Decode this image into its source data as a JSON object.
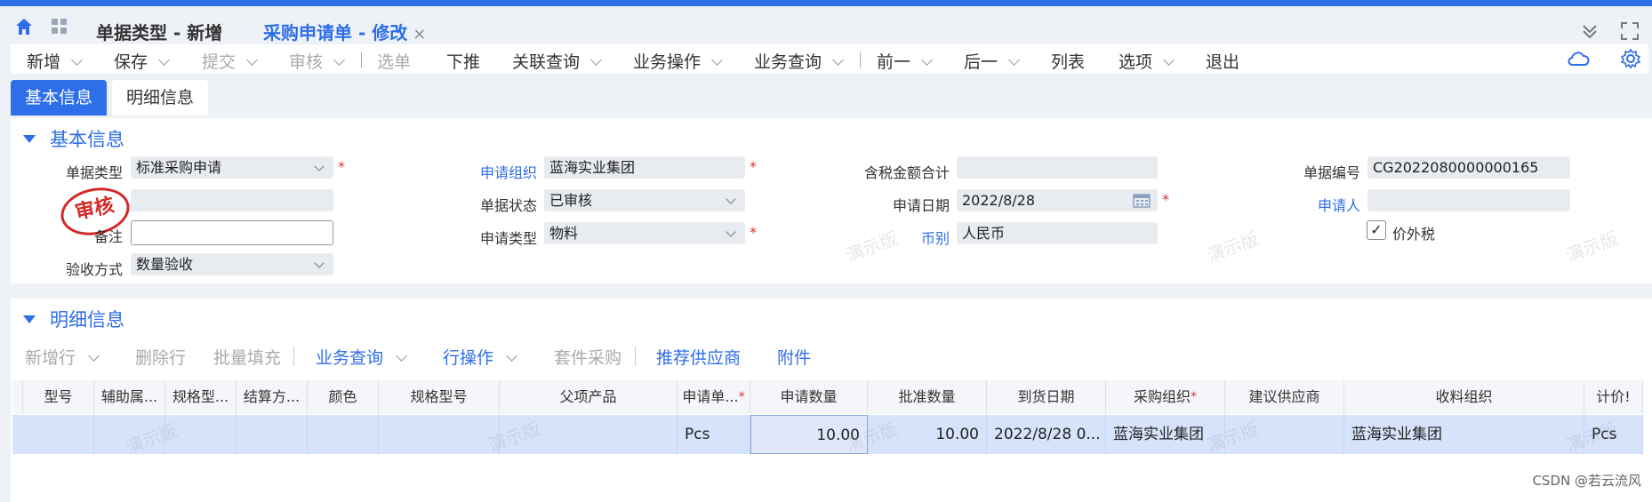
{
  "tabs": [
    {
      "label": "单据类型 - 新增"
    },
    {
      "label": "采购申请单 - 修改",
      "close": "×"
    }
  ],
  "toolbar": [
    {
      "label": "新增",
      "dropdown": true,
      "disabled": false
    },
    {
      "label": "保存",
      "dropdown": true,
      "disabled": false
    },
    {
      "label": "提交",
      "dropdown": true,
      "disabled": true
    },
    {
      "label": "审核",
      "dropdown": true,
      "disabled": true
    },
    {
      "label": "选单",
      "dropdown": false,
      "disabled": true
    },
    {
      "label": "下推",
      "dropdown": false,
      "disabled": false
    },
    {
      "label": "关联查询",
      "dropdown": true,
      "disabled": false
    },
    {
      "label": "业务操作",
      "dropdown": true,
      "disabled": false
    },
    {
      "label": "业务查询",
      "dropdown": true,
      "disabled": false
    },
    {
      "label": "前一",
      "dropdown": true,
      "disabled": false
    },
    {
      "label": "后一",
      "dropdown": true,
      "disabled": false
    },
    {
      "label": "列表",
      "dropdown": false,
      "disabled": false
    },
    {
      "label": "选项",
      "dropdown": true,
      "disabled": false
    },
    {
      "label": "退出",
      "dropdown": false,
      "disabled": false
    }
  ],
  "subtabs": [
    "基本信息",
    "明细信息"
  ],
  "basic": {
    "title": "基本信息",
    "fields": {
      "doc_type": {
        "label": "单据类型",
        "value": "标准采购申请"
      },
      "remark": {
        "label": "备注",
        "value": ""
      },
      "accept_method": {
        "label": "验收方式",
        "value": "数量验收"
      },
      "apply_org": {
        "label": "申请组织",
        "value": "蓝海实业集团"
      },
      "doc_status": {
        "label": "单据状态",
        "value": "已审核"
      },
      "apply_type": {
        "label": "申请类型",
        "value": "物料"
      },
      "tax_total": {
        "label": "含税金额合计",
        "value": ""
      },
      "apply_date": {
        "label": "申请日期",
        "value": "2022/8/28"
      },
      "currency": {
        "label": "币别",
        "value": "人民币"
      },
      "doc_no": {
        "label": "单据编号",
        "value": "CG2022080000000165"
      },
      "applicant": {
        "label": "申请人",
        "value": ""
      },
      "price_excl_tax": {
        "label": "价外税",
        "checked": true,
        "mark": "✓"
      }
    },
    "stamp": "审核",
    "required_mark": "*"
  },
  "detail": {
    "title": "明细信息",
    "toolbar": [
      {
        "label": "新增行",
        "dropdown": true,
        "state": "dis"
      },
      {
        "label": "删除行",
        "dropdown": false,
        "state": "dis"
      },
      {
        "label": "批量填充",
        "dropdown": false,
        "state": "dis"
      },
      {
        "label": "业务查询",
        "dropdown": true,
        "state": "blue"
      },
      {
        "label": "行操作",
        "dropdown": true,
        "state": "blue"
      },
      {
        "label": "套件采购",
        "dropdown": false,
        "state": "dis"
      },
      {
        "label": "推荐供应商",
        "dropdown": false,
        "state": "blue"
      },
      {
        "label": "附件",
        "dropdown": false,
        "state": "blue"
      }
    ],
    "columns": [
      "",
      "型号",
      "辅助属...",
      "规格型...",
      "结算方...",
      "颜色",
      "规格型号",
      "父项产品",
      "申请单...",
      "申请数量",
      "批准数量",
      "到货日期",
      "采购组织",
      "建议供应商",
      "收料组织",
      "计价!"
    ],
    "row": [
      "",
      "",
      "",
      "",
      "",
      "",
      "",
      "",
      "Pcs",
      "10.00",
      "10.00",
      "2022/8/28 0...",
      "蓝海实业集团",
      "",
      "蓝海实业集团",
      "Pcs"
    ]
  },
  "watermark": "演示版",
  "footer": "CSDN @若云流风"
}
